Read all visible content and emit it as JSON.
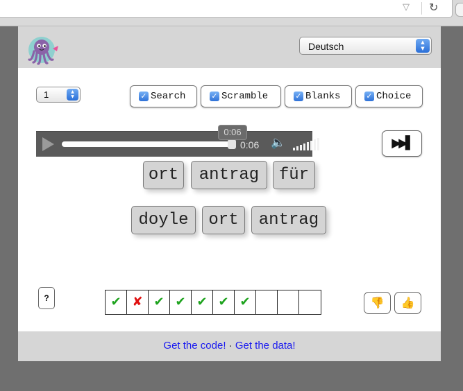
{
  "browser": {
    "dropdown_icon": "▽",
    "reload_icon": "↻"
  },
  "header": {
    "logo": "octopus-logo",
    "language": "Deutsch"
  },
  "controls": {
    "count_value": "1",
    "modes": [
      {
        "label": "Search",
        "checked": true
      },
      {
        "label": "Scramble",
        "checked": true
      },
      {
        "label": "Blanks",
        "checked": true
      },
      {
        "label": "Choice",
        "checked": true
      }
    ]
  },
  "player": {
    "tooltip_time": "0:06",
    "current_time": "0:06",
    "progress_fraction": 1.0
  },
  "next_button_icon": "▶▶▌",
  "prompt_words": [
    "ort",
    "antrag",
    "für"
  ],
  "answer_words": [
    "doyle",
    "ort",
    "antrag"
  ],
  "help_label": "?",
  "progress_results": [
    "correct",
    "wrong",
    "correct",
    "correct",
    "correct",
    "correct",
    "correct",
    "empty",
    "empty",
    "empty"
  ],
  "feedback": {
    "thumbs_down_icon": "thumbs-down",
    "thumbs_up_icon": "thumbs-up"
  },
  "footer": {
    "code_link": "Get the code!",
    "separator": "·",
    "data_link": "Get the data!"
  },
  "colors": {
    "correct": "#1ea31e",
    "wrong": "#e01010",
    "link": "#1a1af0",
    "accent": "#2f72d8"
  }
}
